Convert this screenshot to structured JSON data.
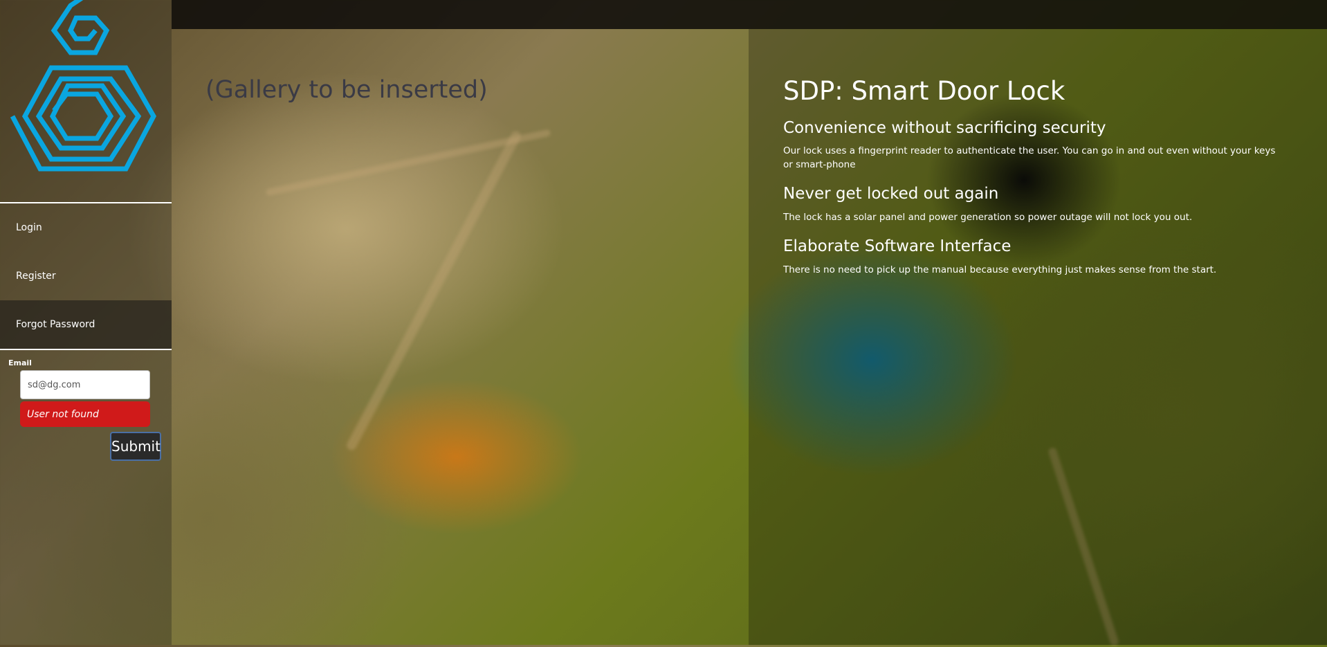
{
  "sidebar": {
    "nav": [
      {
        "label": "Login"
      },
      {
        "label": "Register"
      },
      {
        "label": "Forgot Password"
      }
    ],
    "form": {
      "email_label": "Email",
      "email_value": "sd@dg.com",
      "error": "User not found",
      "submit_label": "Submit"
    }
  },
  "main": {
    "gallery_placeholder": "(Gallery to be inserted)",
    "product": {
      "title": "SDP: Smart Door Lock",
      "features": [
        {
          "heading": "Convenience without sacrificing security",
          "text": "Our lock uses a fingerprint reader to authenticate the user. You can go in and out even without your keys or smart-phone"
        },
        {
          "heading": "Never get locked out again",
          "text": "The lock has a solar panel and power generation so power outage will not lock you out."
        },
        {
          "heading": "Elaborate Software Interface",
          "text": "There is no need to pick up the manual because everything just makes sense from the start."
        }
      ]
    }
  },
  "colors": {
    "logo": "#0aa6e0",
    "error_bg": "#d01a1a"
  }
}
